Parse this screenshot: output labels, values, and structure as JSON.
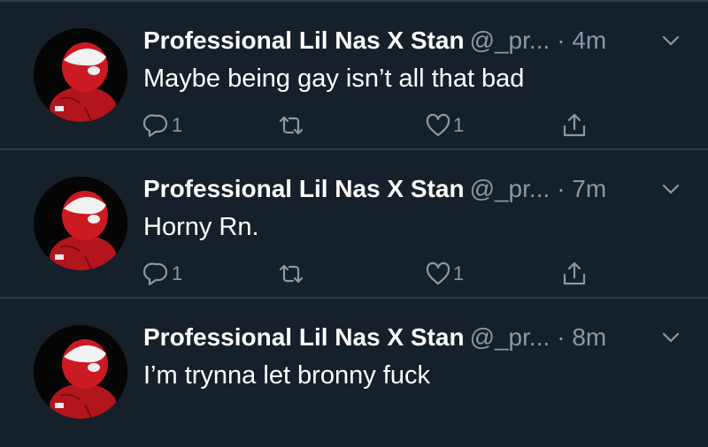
{
  "tweets": [
    {
      "name": "Professional Lil Nas X Stan",
      "handle": "@_pr...",
      "time": "· 4m",
      "text": "Maybe being gay isn’t all that bad",
      "reply_count": "1",
      "like_count": "1"
    },
    {
      "name": "Professional Lil Nas X Stan",
      "handle": "@_pr...",
      "time": "· 7m",
      "text": "Horny Rn.",
      "reply_count": "1",
      "like_count": "1"
    },
    {
      "name": "Professional Lil Nas X Stan",
      "handle": "@_pr...",
      "time": "· 8m",
      "text": "I’m trynna let bronny fuck",
      "reply_count": "",
      "like_count": ""
    }
  ],
  "icons": {
    "avatar": "spider-man-avatar",
    "reply": "reply-icon",
    "retweet": "retweet-icon",
    "like": "heart-icon",
    "share": "share-icon",
    "menu": "chevron-down-icon"
  },
  "colors": {
    "background": "#15202b",
    "secondary_text": "#8899a6",
    "divider": "#2f3b47"
  }
}
